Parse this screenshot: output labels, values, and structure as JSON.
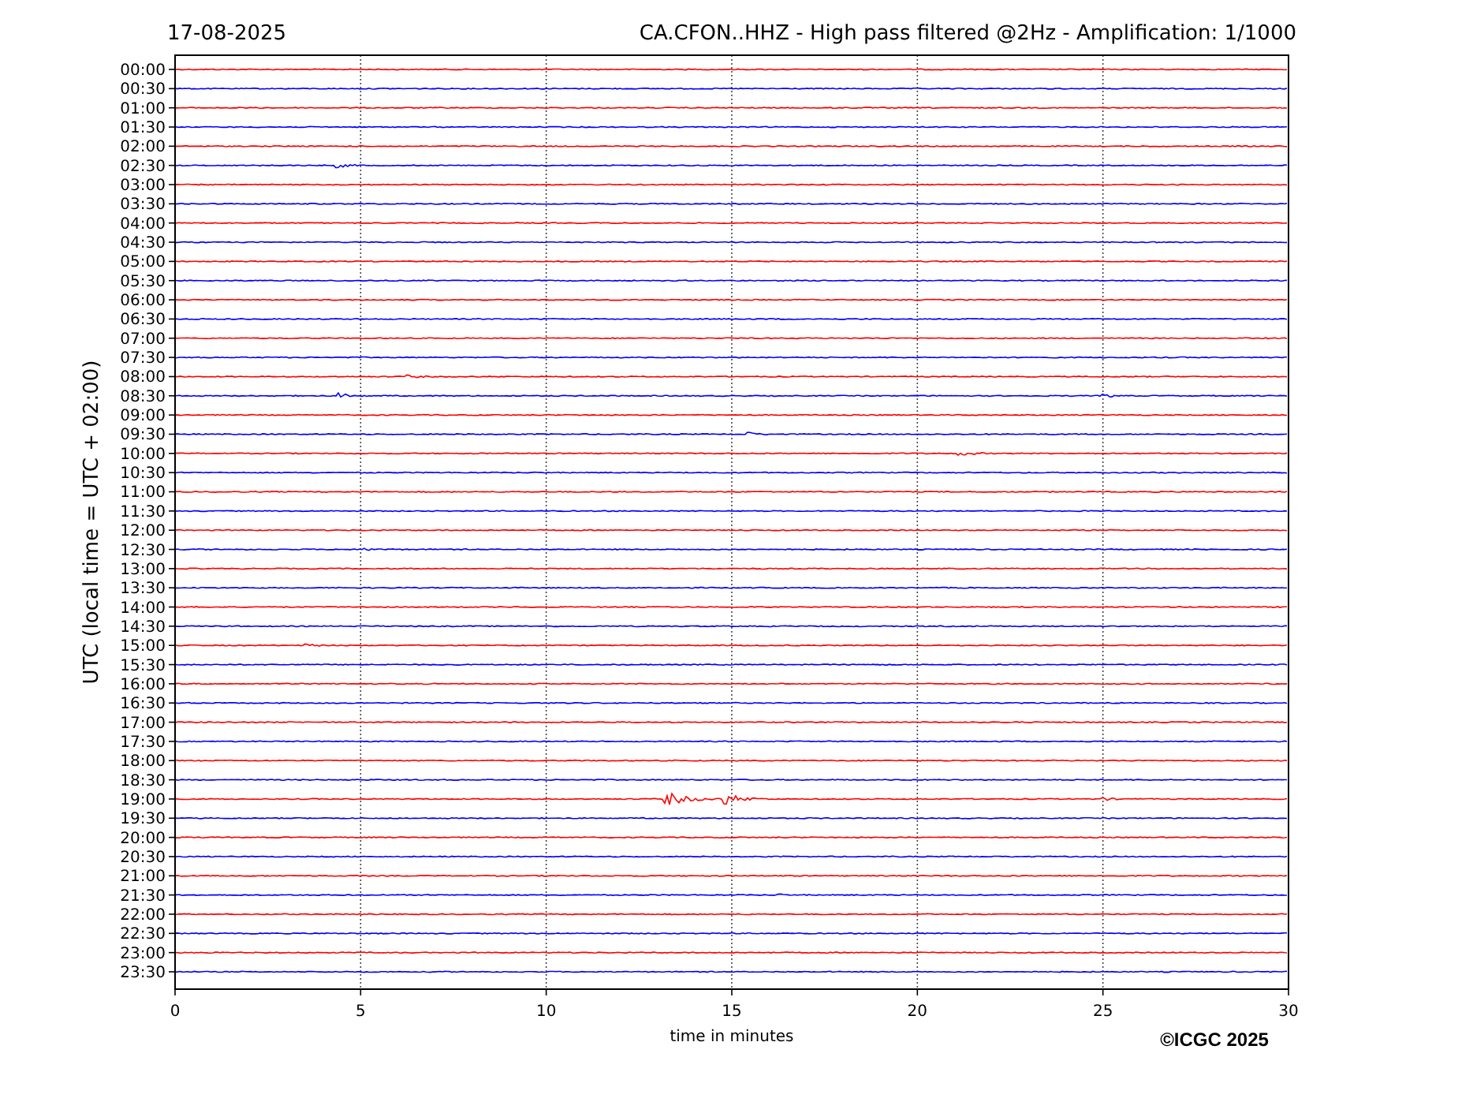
{
  "header": {
    "date": "17-08-2025",
    "title": "CA.CFON..HHZ - High pass filtered @2Hz - Amplification: 1/1000"
  },
  "plot": {
    "ylabel": "UTC (local time = UTC + 02:00)",
    "xlabel": "time in minutes",
    "xticks": [
      "0",
      "5",
      "10",
      "15",
      "20",
      "25",
      "30"
    ],
    "rows": [
      {
        "label": "00:00",
        "color": "#ff0000"
      },
      {
        "label": "00:30",
        "color": "#0000ff"
      },
      {
        "label": "01:00",
        "color": "#ff0000"
      },
      {
        "label": "01:30",
        "color": "#0000ff"
      },
      {
        "label": "02:00",
        "color": "#ff0000"
      },
      {
        "label": "02:30",
        "color": "#0000ff"
      },
      {
        "label": "03:00",
        "color": "#ff0000"
      },
      {
        "label": "03:30",
        "color": "#0000ff"
      },
      {
        "label": "04:00",
        "color": "#ff0000"
      },
      {
        "label": "04:30",
        "color": "#0000ff"
      },
      {
        "label": "05:00",
        "color": "#ff0000"
      },
      {
        "label": "05:30",
        "color": "#0000ff"
      },
      {
        "label": "06:00",
        "color": "#ff0000"
      },
      {
        "label": "06:30",
        "color": "#0000ff"
      },
      {
        "label": "07:00",
        "color": "#ff0000"
      },
      {
        "label": "07:30",
        "color": "#0000ff"
      },
      {
        "label": "08:00",
        "color": "#ff0000"
      },
      {
        "label": "08:30",
        "color": "#0000ff"
      },
      {
        "label": "09:00",
        "color": "#ff0000"
      },
      {
        "label": "09:30",
        "color": "#0000ff"
      },
      {
        "label": "10:00",
        "color": "#ff0000"
      },
      {
        "label": "10:30",
        "color": "#0000ff"
      },
      {
        "label": "11:00",
        "color": "#ff0000"
      },
      {
        "label": "11:30",
        "color": "#0000ff"
      },
      {
        "label": "12:00",
        "color": "#ff0000"
      },
      {
        "label": "12:30",
        "color": "#0000ff"
      },
      {
        "label": "13:00",
        "color": "#ff0000"
      },
      {
        "label": "13:30",
        "color": "#0000ff"
      },
      {
        "label": "14:00",
        "color": "#ff0000"
      },
      {
        "label": "14:30",
        "color": "#0000ff"
      },
      {
        "label": "15:00",
        "color": "#ff0000"
      },
      {
        "label": "15:30",
        "color": "#0000ff"
      },
      {
        "label": "16:00",
        "color": "#ff0000"
      },
      {
        "label": "16:30",
        "color": "#0000ff"
      },
      {
        "label": "17:00",
        "color": "#ff0000"
      },
      {
        "label": "17:30",
        "color": "#0000ff"
      },
      {
        "label": "18:00",
        "color": "#ff0000"
      },
      {
        "label": "18:30",
        "color": "#0000ff"
      },
      {
        "label": "19:00",
        "color": "#ff0000"
      },
      {
        "label": "19:30",
        "color": "#0000ff"
      },
      {
        "label": "20:00",
        "color": "#ff0000"
      },
      {
        "label": "20:30",
        "color": "#0000ff"
      },
      {
        "label": "21:00",
        "color": "#ff0000"
      },
      {
        "label": "21:30",
        "color": "#0000ff"
      },
      {
        "label": "22:00",
        "color": "#ff0000"
      },
      {
        "label": "22:30",
        "color": "#0000ff"
      },
      {
        "label": "23:00",
        "color": "#ff0000"
      },
      {
        "label": "23:30",
        "color": "#0000ff"
      }
    ]
  },
  "copyright": "©ICGC 2025"
}
